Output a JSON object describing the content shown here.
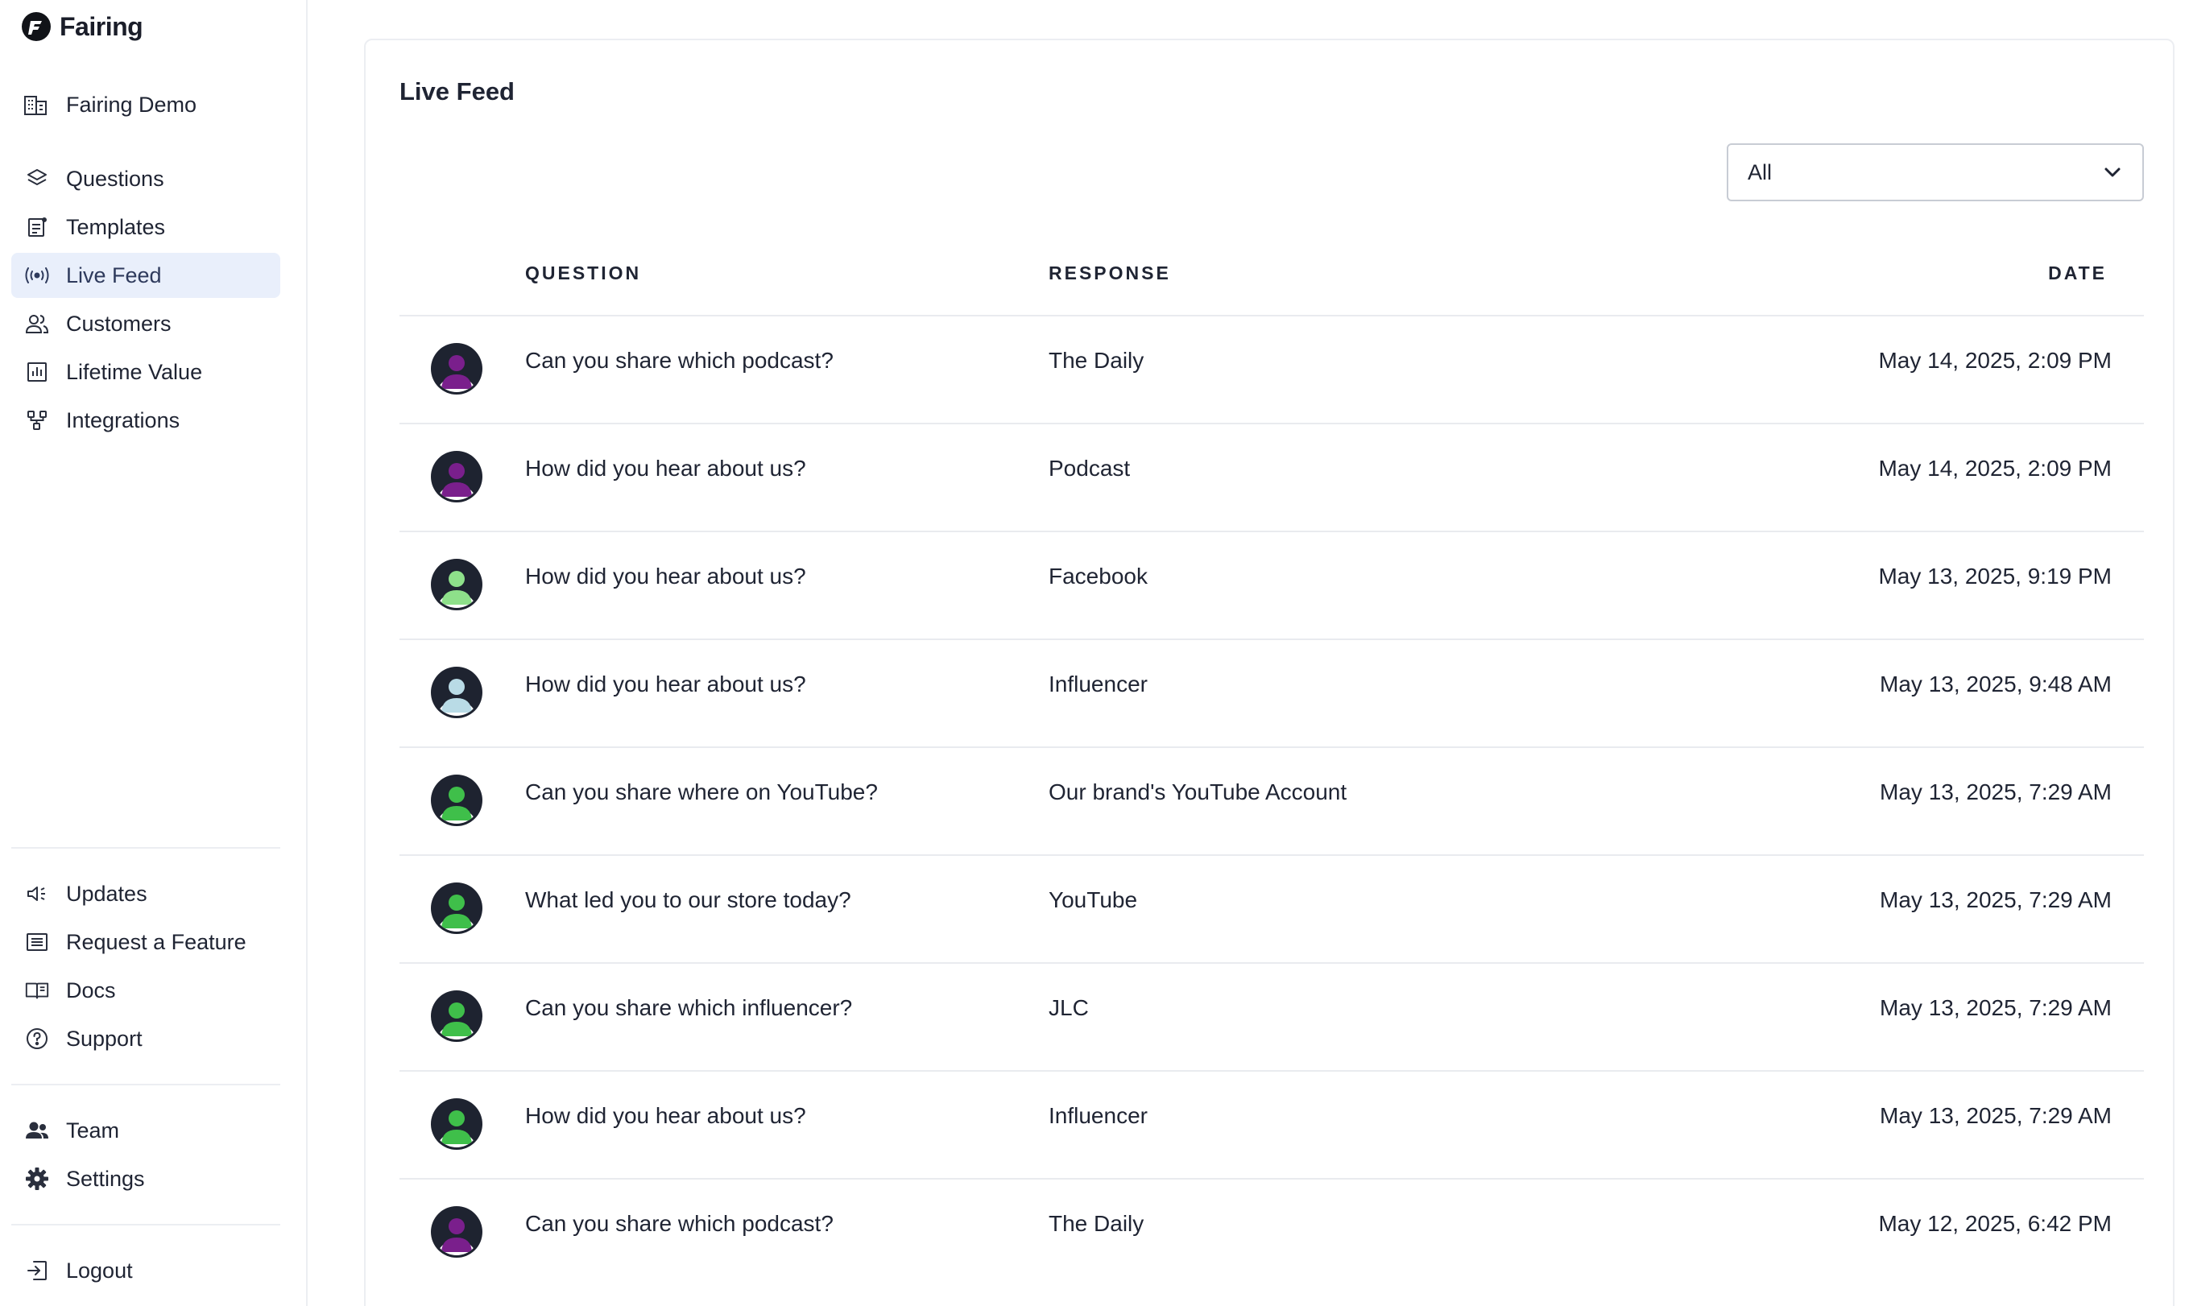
{
  "app": {
    "name": "Fairing"
  },
  "sidebar": {
    "workspace": "Fairing Demo",
    "nav": [
      {
        "label": "Questions",
        "icon": "layers-icon"
      },
      {
        "label": "Templates",
        "icon": "template-icon"
      },
      {
        "label": "Live Feed",
        "icon": "broadcast-icon",
        "active": true
      },
      {
        "label": "Customers",
        "icon": "users-icon"
      },
      {
        "label": "Lifetime Value",
        "icon": "bar-chart-icon"
      },
      {
        "label": "Integrations",
        "icon": "integrations-icon"
      }
    ],
    "secondary": [
      {
        "label": "Updates",
        "icon": "megaphone-icon"
      },
      {
        "label": "Request a Feature",
        "icon": "list-icon"
      },
      {
        "label": "Docs",
        "icon": "book-icon"
      },
      {
        "label": "Support",
        "icon": "help-circle-icon"
      }
    ],
    "account": [
      {
        "label": "Team",
        "icon": "team-icon"
      },
      {
        "label": "Settings",
        "icon": "gear-icon"
      }
    ],
    "logout": {
      "label": "Logout",
      "icon": "logout-icon"
    }
  },
  "main": {
    "title": "Live Feed",
    "filter": {
      "value": "All"
    },
    "columns": {
      "question": "QUESTION",
      "response": "RESPONSE",
      "date": "DATE"
    },
    "rows": [
      {
        "question": "Can you share which podcast?",
        "response": "The Daily",
        "date": "May 14, 2025, 2:09 PM",
        "avatar_color": "#7a1f8c"
      },
      {
        "question": "How did you hear about us?",
        "response": "Podcast",
        "date": "May 14, 2025, 2:09 PM",
        "avatar_color": "#7a1f8c"
      },
      {
        "question": "How did you hear about us?",
        "response": "Facebook",
        "date": "May 13, 2025, 9:19 PM",
        "avatar_color": "#8ee08a"
      },
      {
        "question": "How did you hear about us?",
        "response": "Influencer",
        "date": "May 13, 2025, 9:48 AM",
        "avatar_color": "#b9dbe6"
      },
      {
        "question": "Can you share where on YouTube?",
        "response": "Our brand's YouTube Account",
        "date": "May 13, 2025, 7:29 AM",
        "avatar_color": "#3fbf4a"
      },
      {
        "question": "What led you to our store today?",
        "response": "YouTube",
        "date": "May 13, 2025, 7:29 AM",
        "avatar_color": "#3fbf4a"
      },
      {
        "question": "Can you share which influencer?",
        "response": "JLC",
        "date": "May 13, 2025, 7:29 AM",
        "avatar_color": "#3fbf4a"
      },
      {
        "question": "How did you hear about us?",
        "response": "Influencer",
        "date": "May 13, 2025, 7:29 AM",
        "avatar_color": "#3fbf4a"
      },
      {
        "question": "Can you share which podcast?",
        "response": "The Daily",
        "date": "May 12, 2025, 6:42 PM",
        "avatar_color": "#7a1f8c"
      }
    ]
  }
}
